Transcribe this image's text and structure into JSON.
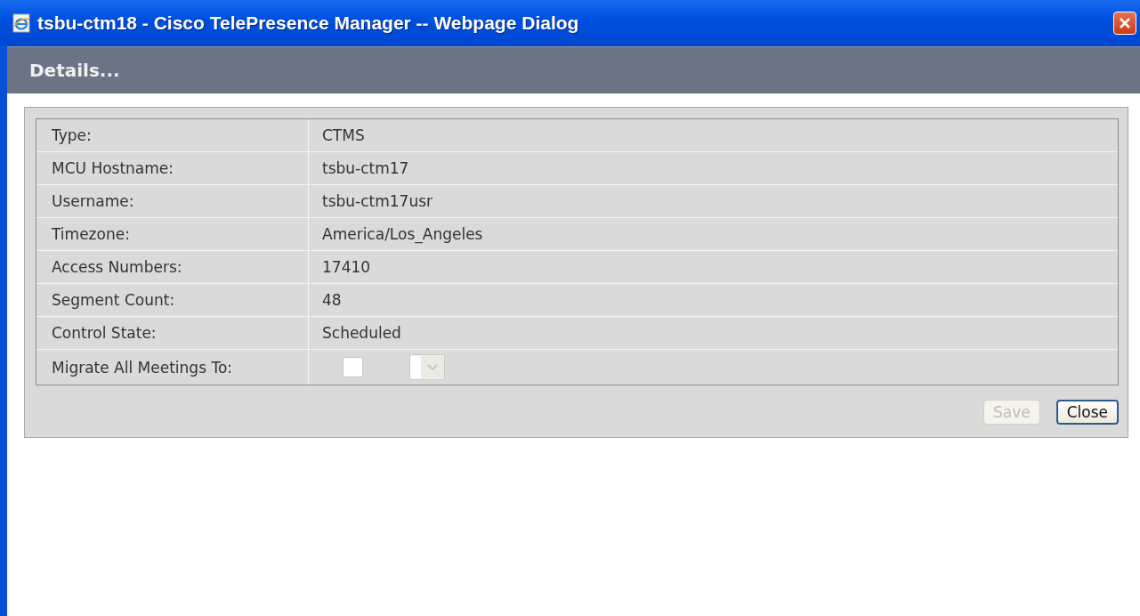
{
  "window": {
    "title": "tsbu-ctm18 - Cisco TelePresence Manager -- Webpage Dialog"
  },
  "header": "Details...",
  "rows": [
    {
      "kind": "text",
      "label": "Type:",
      "value": "CTMS"
    },
    {
      "kind": "text",
      "label": "MCU Hostname:",
      "value": "tsbu-ctm17"
    },
    {
      "kind": "text",
      "label": "Username:",
      "value": "tsbu-ctm17usr"
    },
    {
      "kind": "text",
      "label": "Timezone:",
      "value": "America/Los_Angeles"
    },
    {
      "kind": "text",
      "label": "Access Numbers:",
      "value": "17410"
    },
    {
      "kind": "text",
      "label": "Segment Count:",
      "value": "48"
    },
    {
      "kind": "text",
      "label": "Control State:",
      "value": "Scheduled"
    },
    {
      "kind": "migrate",
      "label": "Migrate All Meetings To:",
      "checked": false,
      "dropdown_disabled": true
    }
  ],
  "buttons": [
    {
      "label": "Save",
      "disabled": true
    },
    {
      "label": "Close",
      "disabled": false
    }
  ]
}
